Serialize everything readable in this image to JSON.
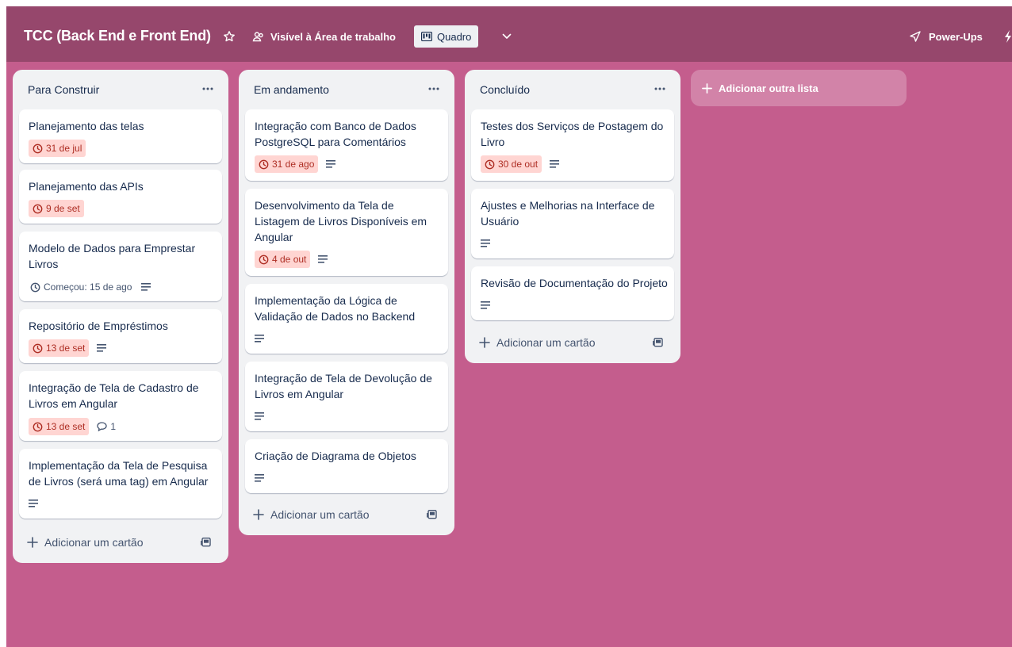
{
  "header": {
    "board_title": "TCC (Back End e Front End)",
    "visibility_label": "Visível à Área de trabalho",
    "view_label": "Quadro",
    "powerups_label": "Power-Ups"
  },
  "lists": [
    {
      "title": "Para Construir",
      "cards": [
        {
          "title": "Planejamento das telas",
          "due": "31 de jul"
        },
        {
          "title": "Planejamento das APIs",
          "due": "9 de set"
        },
        {
          "title": "Modelo de Dados para Emprestar Livros",
          "start": "Começou: 15 de ago",
          "has_description": true
        },
        {
          "title": "Repositório de Empréstimos",
          "due": "13 de set",
          "has_description": true
        },
        {
          "title": "Integração de Tela de Cadastro de Livros em Angular",
          "due": "13 de set",
          "comments": "1"
        },
        {
          "title": "Implementação da Tela de Pesquisa de Livros (será uma tag) em Angular",
          "has_description": true
        }
      ],
      "add_card_label": "Adicionar um cartão"
    },
    {
      "title": "Em andamento",
      "cards": [
        {
          "title": "Integração com Banco de Dados PostgreSQL para Comentários",
          "due": "31 de ago",
          "has_description": true
        },
        {
          "title": "Desenvolvimento da Tela de Listagem de Livros Disponíveis em Angular",
          "due": "4 de out",
          "has_description": true
        },
        {
          "title": "Implementação da Lógica de Validação de Dados no Backend",
          "has_description": true
        },
        {
          "title": "Integração de Tela de Devolução de Livros em Angular",
          "has_description": true
        },
        {
          "title": "Criação de Diagrama de Objetos",
          "has_description": true
        }
      ],
      "add_card_label": "Adicionar um cartão"
    },
    {
      "title": "Concluído",
      "cards": [
        {
          "title": "Testes dos Serviços de Postagem do Livro",
          "due": "30 de out",
          "has_description": true
        },
        {
          "title": "Ajustes e Melhorias na Interface de Usuário",
          "has_description": true
        },
        {
          "title": "Revisão de Documentação do Projeto",
          "has_description": true
        }
      ],
      "add_card_label": "Adicionar um cartão"
    }
  ],
  "add_list_label": "Adicionar outra lista",
  "colors": {
    "board_background": "#c45d8d",
    "header_background": "#96476c",
    "due_overdue_bg": "#ffd5d2",
    "due_overdue_text": "#ae2e24"
  },
  "icons": [
    "star-icon",
    "visibility-icon",
    "board-icon",
    "chevron-down-icon",
    "rocket-icon",
    "lightning-icon",
    "more-icon",
    "clock-icon",
    "description-icon",
    "comment-icon",
    "plus-icon",
    "card-template-icon"
  ]
}
